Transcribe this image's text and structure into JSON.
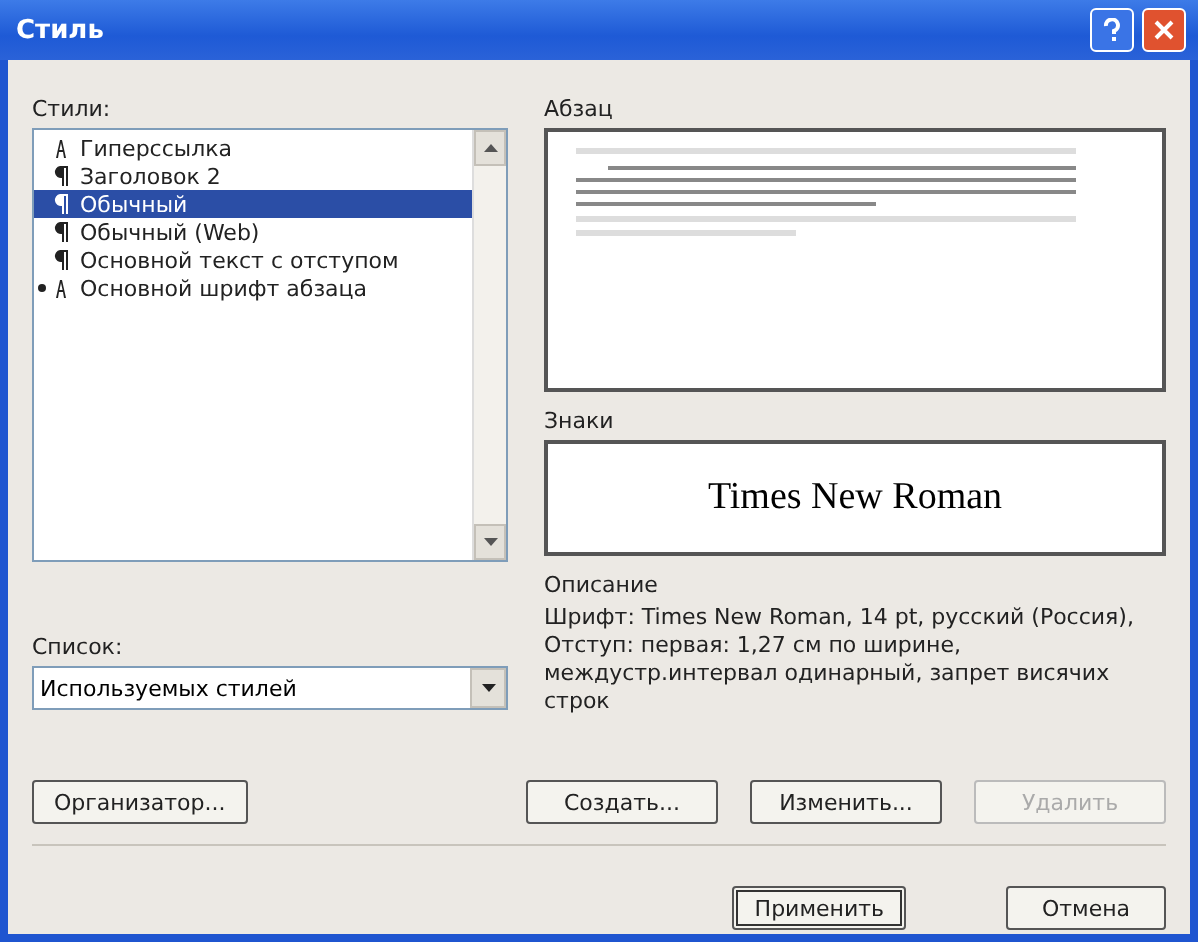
{
  "window": {
    "title": "Стиль"
  },
  "styles": {
    "label": "Стили:",
    "items": [
      {
        "name": "Гиперссылка",
        "kind": "character",
        "selected": false,
        "marked": false
      },
      {
        "name": "Заголовок 2",
        "kind": "paragraph",
        "selected": false,
        "marked": false
      },
      {
        "name": "Обычный",
        "kind": "paragraph",
        "selected": true,
        "marked": false
      },
      {
        "name": "Обычный (Web)",
        "kind": "paragraph",
        "selected": false,
        "marked": false
      },
      {
        "name": "Основной текст с отступом",
        "kind": "paragraph",
        "selected": false,
        "marked": false
      },
      {
        "name": "Основной шрифт абзаца",
        "kind": "character",
        "selected": false,
        "marked": true
      }
    ]
  },
  "list": {
    "label": "Список:",
    "value": "Используемых стилей"
  },
  "paragraph_preview": {
    "label": "Абзац"
  },
  "character_preview": {
    "label": "Знаки",
    "sample": "Times New Roman"
  },
  "description": {
    "label": "Описание",
    "text": "Шрифт: Times New Roman, 14 pt, русский (Россия), Отступ: первая: 1,27 см по ширине, междустр.интервал одинарный, запрет висячих строк"
  },
  "buttons": [
    {
      "label": "Организатор...",
      "disabled": false
    },
    {
      "label": "Создать...",
      "disabled": false
    },
    {
      "label": "Изменить...",
      "disabled": false
    },
    {
      "label": "Удалить",
      "disabled": true
    }
  ],
  "footer_buttons": [
    {
      "label": "Применить",
      "default": true
    },
    {
      "label": "Отмена",
      "default": false
    }
  ]
}
